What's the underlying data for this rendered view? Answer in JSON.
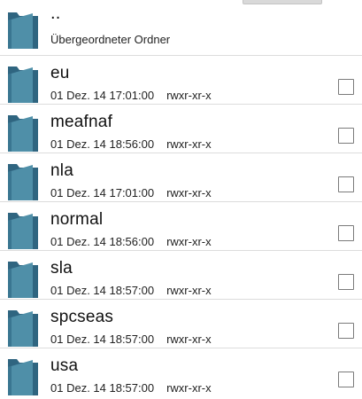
{
  "parent": {
    "name": "..",
    "subtitle": "Übergeordneter Ordner"
  },
  "items": [
    {
      "name": "eu",
      "date": "01 Dez. 14 17:01:00",
      "perms": "rwxr-xr-x",
      "checked": false
    },
    {
      "name": "meafnaf",
      "date": "01 Dez. 14 18:56:00",
      "perms": "rwxr-xr-x",
      "checked": false
    },
    {
      "name": "nla",
      "date": "01 Dez. 14 17:01:00",
      "perms": "rwxr-xr-x",
      "checked": false
    },
    {
      "name": "normal",
      "date": "01 Dez. 14 18:56:00",
      "perms": "rwxr-xr-x",
      "checked": false
    },
    {
      "name": "sla",
      "date": "01 Dez. 14 18:57:00",
      "perms": "rwxr-xr-x",
      "checked": false
    },
    {
      "name": "spcseas",
      "date": "01 Dez. 14 18:57:00",
      "perms": "rwxr-xr-x",
      "checked": false
    },
    {
      "name": "usa",
      "date": "01 Dez. 14 18:57:00",
      "perms": "rwxr-xr-x",
      "checked": false
    }
  ],
  "colors": {
    "folder_front": "#4f8fa8",
    "folder_back": "#2f6580",
    "folder_shade": "#3a7691"
  }
}
